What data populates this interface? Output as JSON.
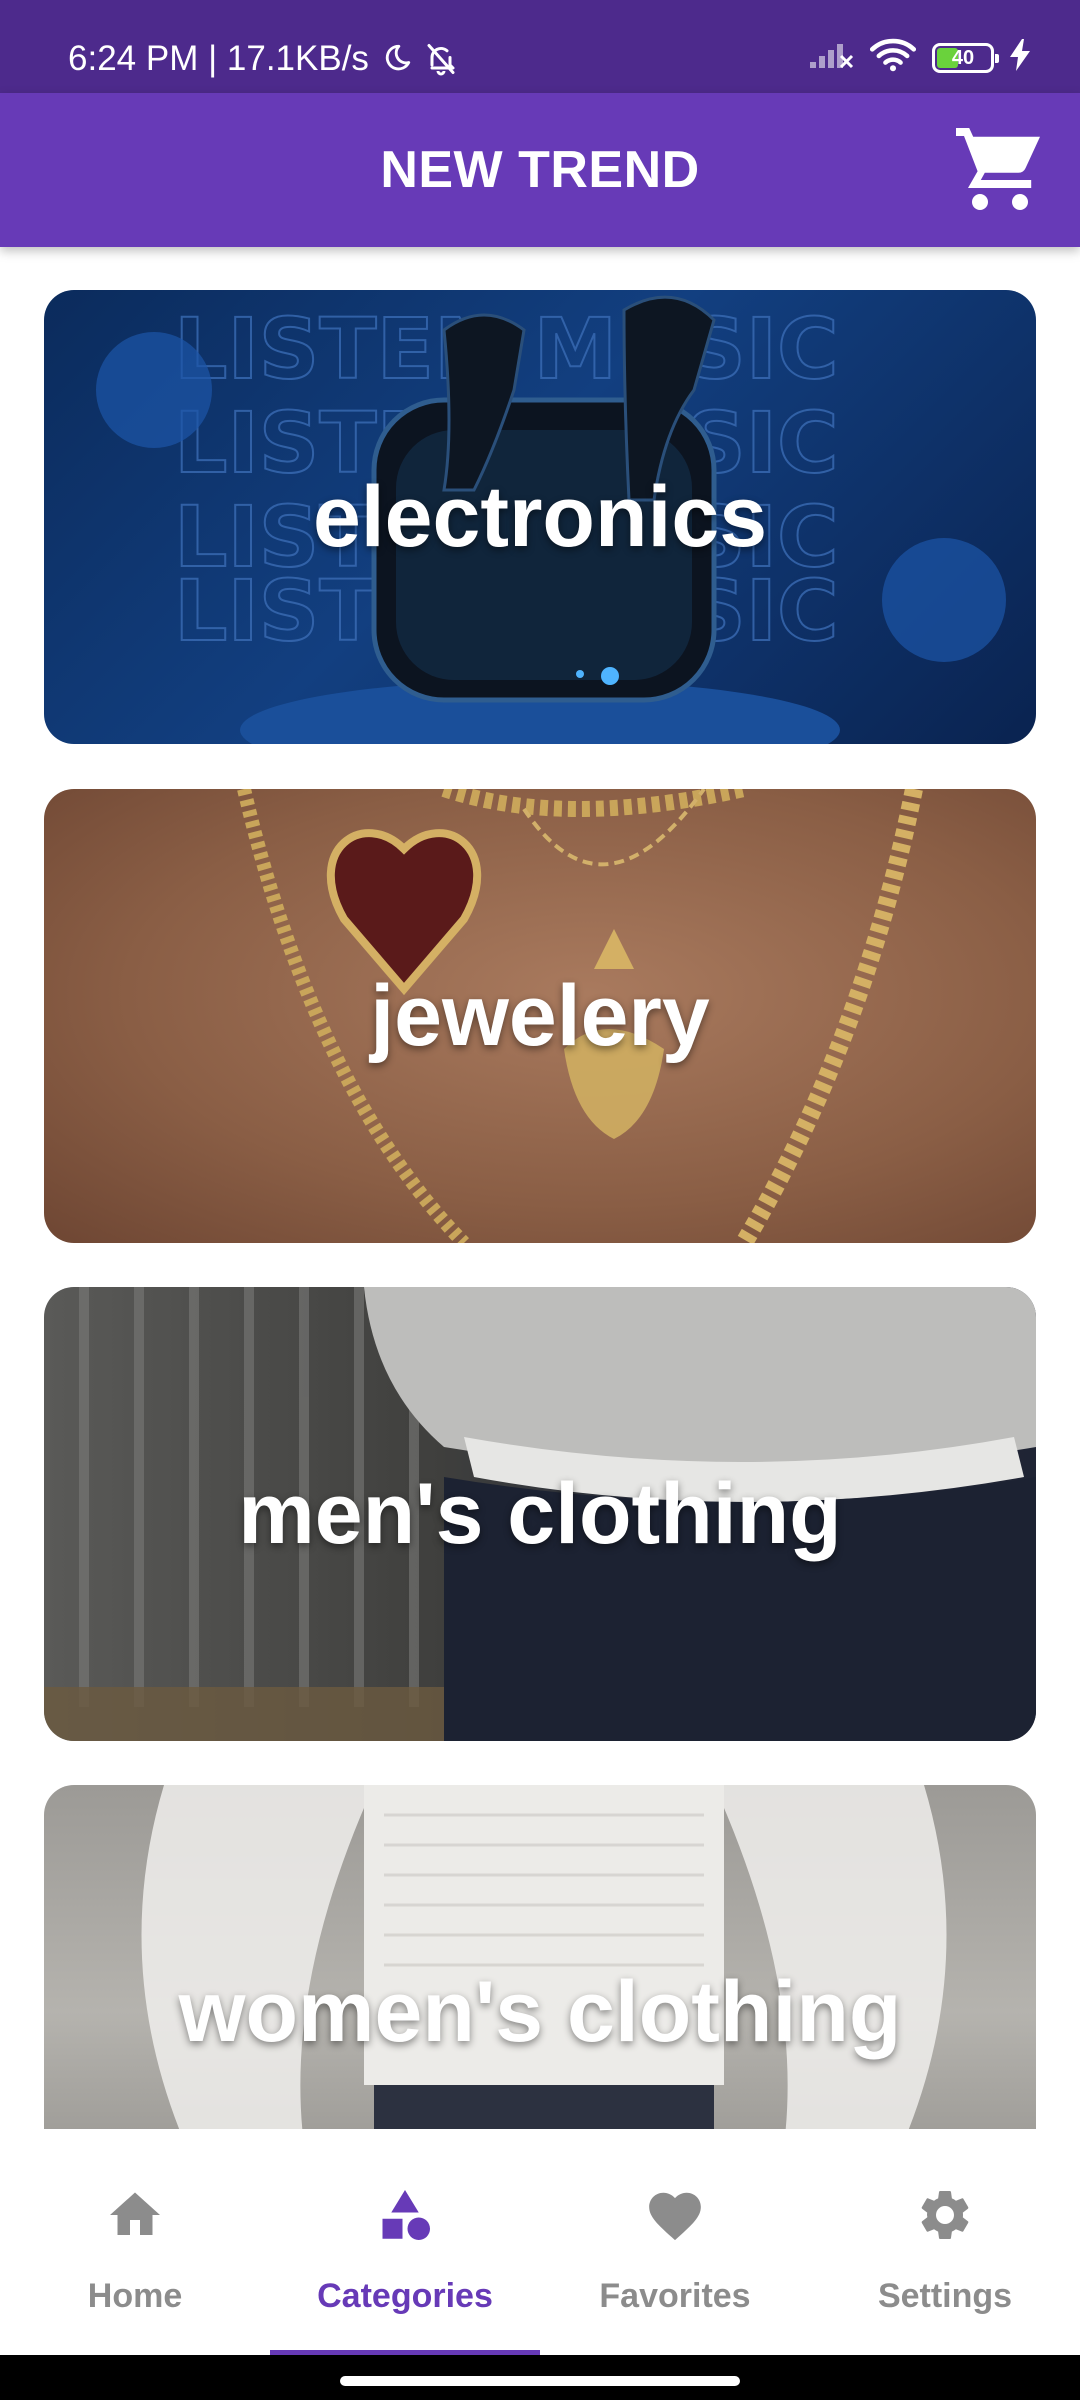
{
  "status_bar": {
    "time_info": "6:24 PM | 17.1KB/s",
    "battery_level": "40",
    "battery_fraction": 0.4
  },
  "app_bar": {
    "title": "NEW TREND",
    "cart_icon": "cart-icon"
  },
  "categories": [
    {
      "label": "electronics"
    },
    {
      "label": "jewelery"
    },
    {
      "label": "men's clothing"
    },
    {
      "label": "women's clothing"
    }
  ],
  "electronics_art_text": "LISTEN MUSIC",
  "bottom_nav": {
    "items": [
      {
        "label": "Home",
        "icon": "home-icon",
        "active": false
      },
      {
        "label": "Categories",
        "icon": "shapes-icon",
        "active": true
      },
      {
        "label": "Favorites",
        "icon": "heart-icon",
        "active": false
      },
      {
        "label": "Settings",
        "icon": "gear-icon",
        "active": false
      }
    ]
  },
  "colors": {
    "status_bar": "#4d2a8c",
    "primary": "#673ab7",
    "inactive_nav": "#8c8c8c",
    "battery_fill": "#6ad23c"
  }
}
